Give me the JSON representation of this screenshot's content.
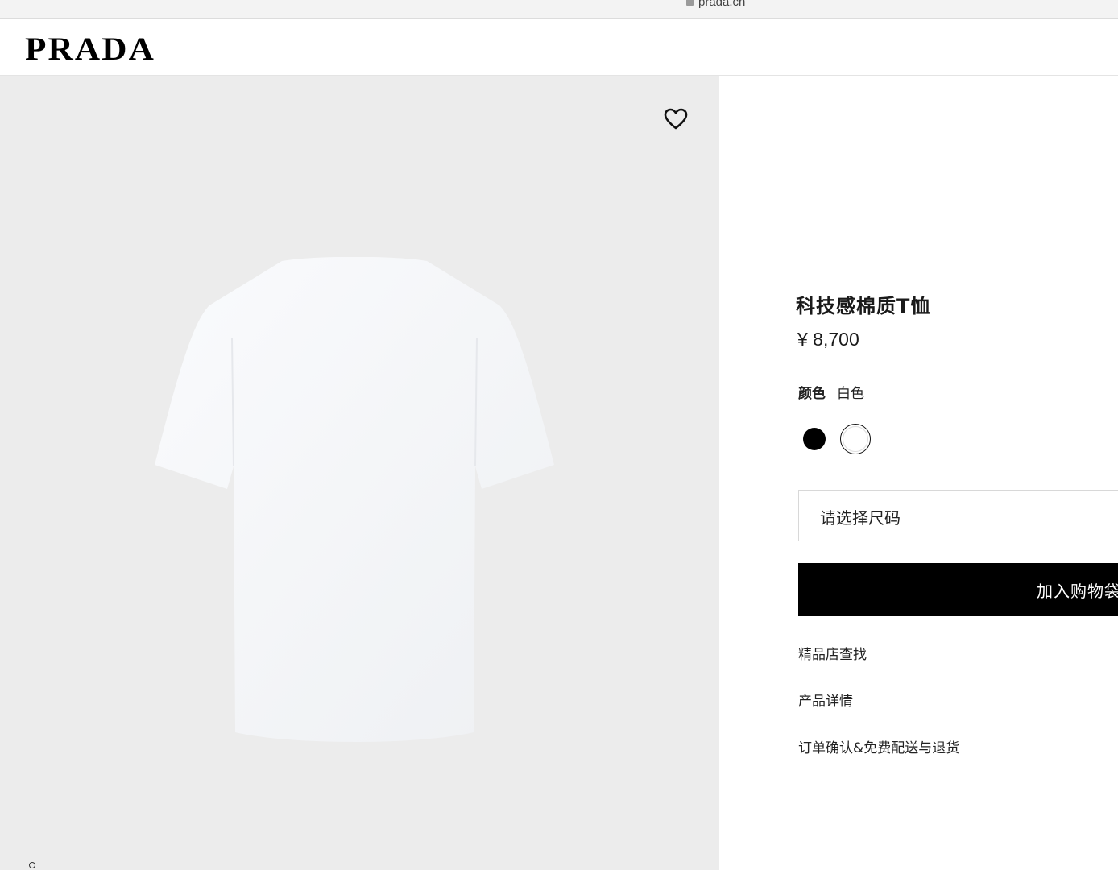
{
  "browser": {
    "url": "prada.cn"
  },
  "header": {
    "logo": "PRADA"
  },
  "gallery": {
    "wishlist_icon": "heart-outline-icon"
  },
  "product": {
    "name": "科技感棉质T恤",
    "price": "¥ 8,700",
    "color_label": "颜色",
    "color_value": "白色",
    "swatches": [
      {
        "name": "black",
        "color": "#000000"
      },
      {
        "name": "white",
        "color": "#ffffff",
        "selected": true
      }
    ],
    "size_placeholder": "请选择尺码",
    "add_to_bag_label": "加入购物袋",
    "links": {
      "store": "精品店查找",
      "details": "产品详情",
      "shipping": "订单确认&免费配送与退货"
    }
  }
}
